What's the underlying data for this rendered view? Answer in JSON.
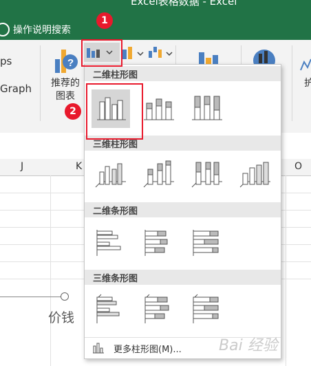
{
  "window": {
    "title": "Excel表格数据  -  Excel"
  },
  "tell_me": {
    "label": "操作说明搜索"
  },
  "ribbon": {
    "partial_top": "ps",
    "partial_bottom": "Graph",
    "recommended_line1": "推荐的",
    "recommended_line2": "图表",
    "cut_right": "护"
  },
  "callouts": {
    "first": "1",
    "second": "2"
  },
  "columns": [
    "J",
    "K",
    "O"
  ],
  "chart": {
    "label": "价钱"
  },
  "dropdown": {
    "sections": [
      "二维柱形图",
      "三维柱形图",
      "二维条形图",
      "三维条形图"
    ],
    "more_label": "更多柱形图(M)..."
  },
  "watermark": "Bai 经验"
}
